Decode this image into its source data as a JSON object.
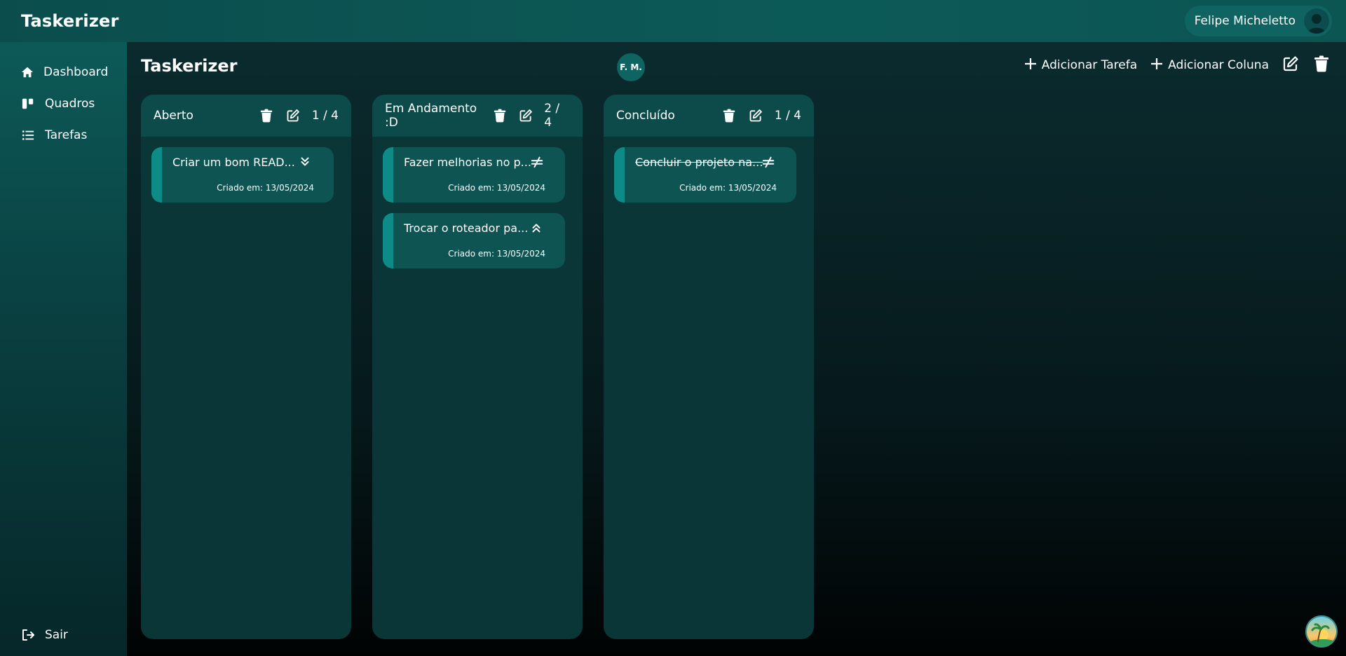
{
  "app": {
    "brand": "Taskerizer",
    "user_name": "Felipe Micheletto"
  },
  "sidebar": {
    "items": [
      {
        "label": "Dashboard",
        "icon": "home-icon"
      },
      {
        "label": "Quadros",
        "icon": "board-icon"
      },
      {
        "label": "Tarefas",
        "icon": "list-icon"
      }
    ],
    "logout_label": "Sair"
  },
  "board": {
    "title": "Taskerizer",
    "member_initials": "F. M.",
    "add_task_label": "Adicionar Tarefa",
    "add_column_label": "Adicionar Coluna"
  },
  "columns": [
    {
      "title": "Aberto",
      "count": "1 / 4",
      "cards": [
        {
          "title": "Criar um bom READ...",
          "date": "Criado em: 13/05/2024",
          "priority_icon": "double-chevron-down-icon",
          "done": false
        }
      ]
    },
    {
      "title": "Em Andamento :D",
      "count": "2 / 4",
      "cards": [
        {
          "title": "Fazer melhorias no p...",
          "date": "Criado em: 13/05/2024",
          "priority_icon": "not-equal-icon",
          "done": false
        },
        {
          "title": "Trocar o roteador pa...",
          "date": "Criado em: 13/05/2024",
          "priority_icon": "double-chevron-up-icon",
          "done": false
        }
      ]
    },
    {
      "title": "Concluído",
      "count": "1 / 4",
      "cards": [
        {
          "title": "Concluir o projeto na...",
          "date": "Criado em: 13/05/2024",
          "priority_icon": "not-equal-icon",
          "done": true
        }
      ]
    }
  ],
  "colors": {
    "accent": "#0e8b87",
    "card": "#0d5452",
    "column": "#0a3638",
    "header": "#0c5a58"
  }
}
